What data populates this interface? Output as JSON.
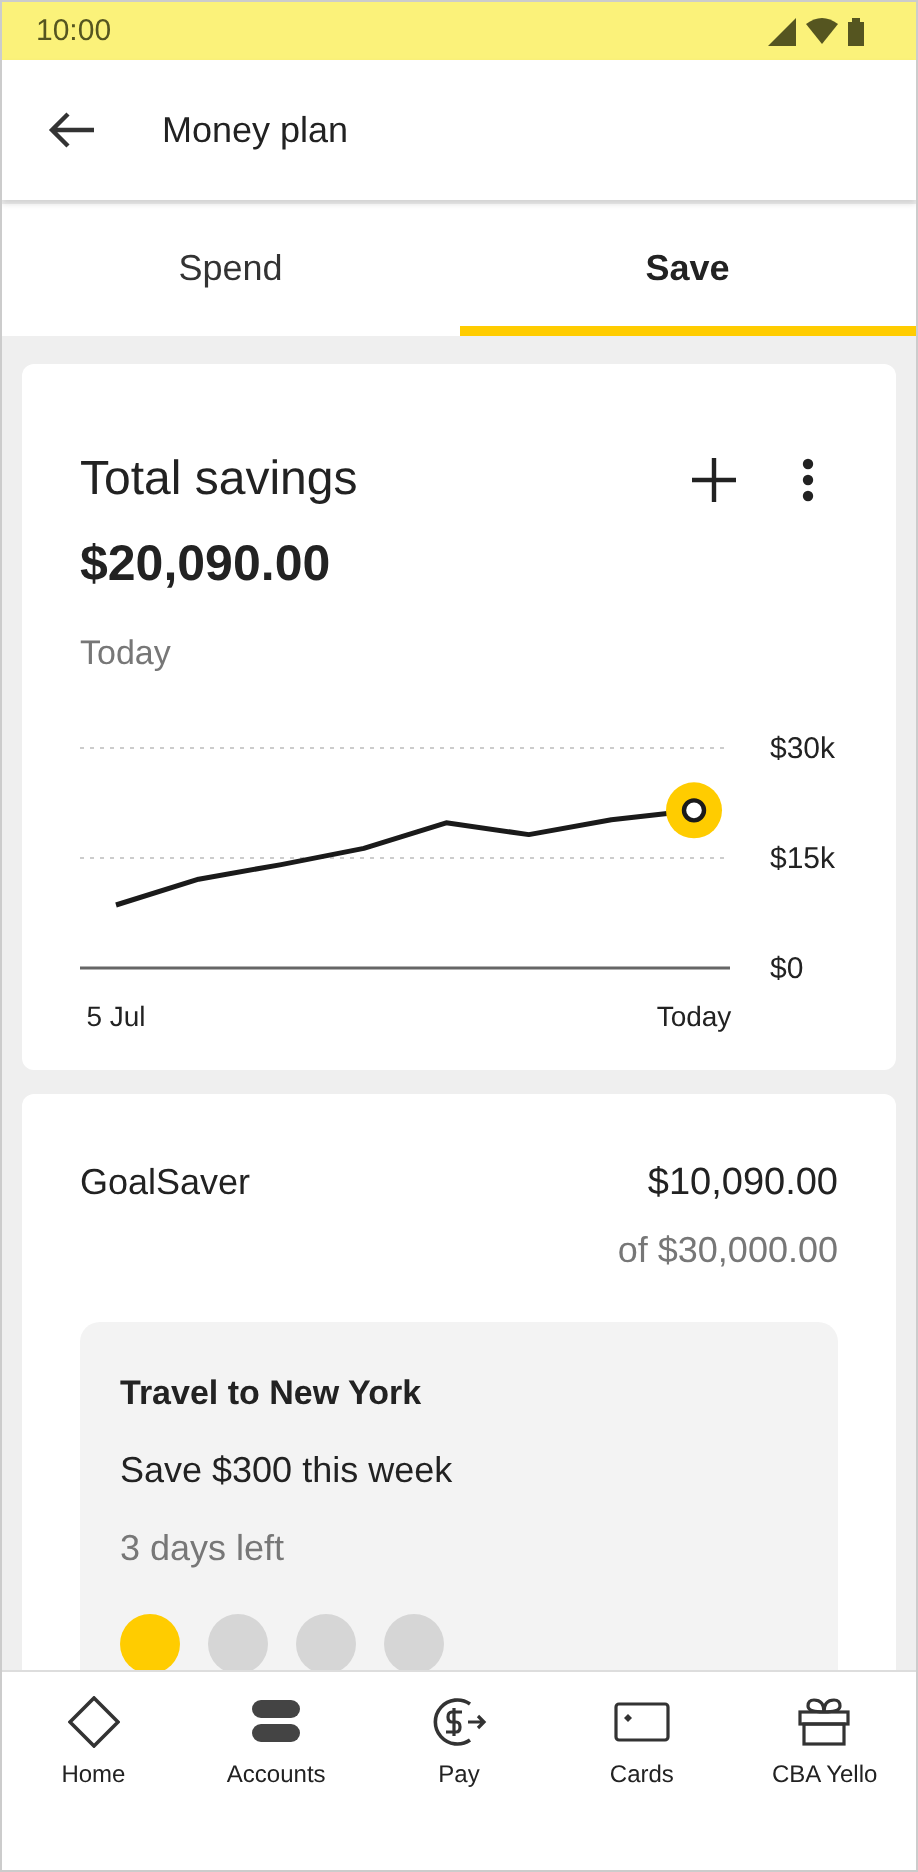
{
  "status_bar": {
    "time": "10:00"
  },
  "header": {
    "title": "Money plan"
  },
  "tabs": [
    {
      "label": "Spend",
      "selected": false
    },
    {
      "label": "Save",
      "selected": true
    }
  ],
  "savings_card": {
    "title": "Total savings",
    "amount": "$20,090.00",
    "date": "Today",
    "chart_data": {
      "type": "line",
      "categories": [
        "5 Jul",
        null,
        null,
        null,
        null,
        null,
        null,
        "Today"
      ],
      "series": [
        {
          "color": "#1a1a1a",
          "values": [
            8600,
            12100,
            14100,
            16300,
            19800,
            18200,
            20200,
            21500
          ]
        }
      ],
      "ylim": [
        0,
        30000
      ],
      "yticks": [
        {
          "value": 0,
          "label": "$0"
        },
        {
          "value": 15000,
          "label": "$15k"
        },
        {
          "value": 30000,
          "label": "$30k"
        }
      ]
    }
  },
  "goal_card": {
    "name": "GoalSaver",
    "balance": "$10,090.00",
    "target": "of $30,000.00",
    "goal": {
      "title": "Travel to New York",
      "task": "Save $300 this week",
      "remaining": "3 days left",
      "steps": [
        {
          "done": true
        },
        {
          "done": false
        },
        {
          "done": false
        },
        {
          "done": false
        }
      ]
    }
  },
  "bottom_nav": [
    {
      "label": "Home",
      "kind": "home"
    },
    {
      "label": "Accounts",
      "kind": "accounts"
    },
    {
      "label": "Pay",
      "kind": "pay"
    },
    {
      "label": "Cards",
      "kind": "cards"
    },
    {
      "label": "CBA Yello",
      "kind": "gift"
    }
  ]
}
